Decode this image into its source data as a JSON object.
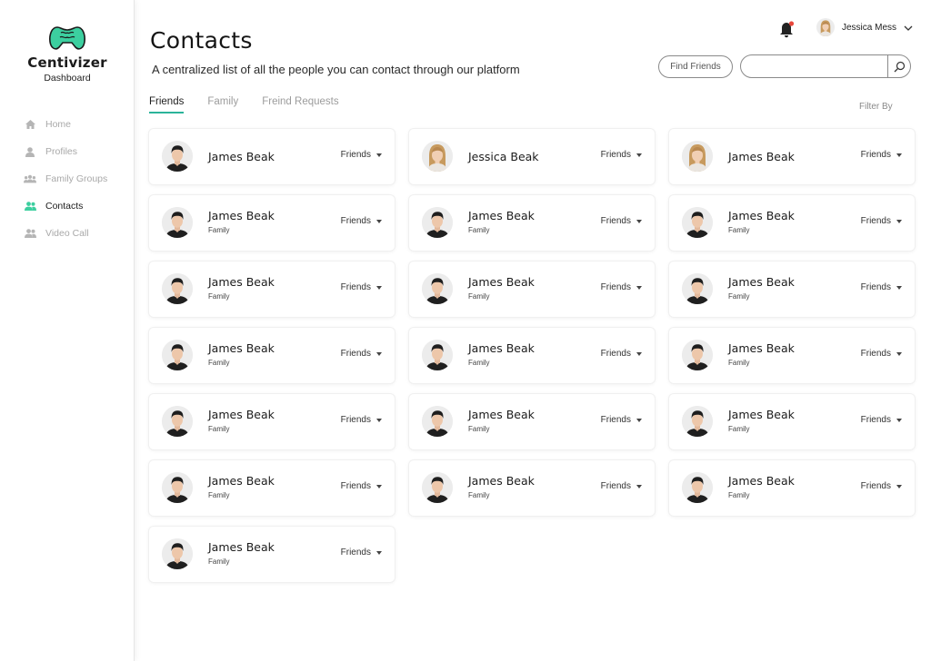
{
  "sidebar": {
    "brand": "Centivizer",
    "brand_sub": "Dashboard",
    "logo_icon": "gamepad-brain-logo",
    "items": [
      {
        "label": "Home",
        "icon": "home-icon",
        "active": false
      },
      {
        "label": "Profiles",
        "icon": "person-icon",
        "active": false
      },
      {
        "label": "Family Groups",
        "icon": "group-icon",
        "active": false
      },
      {
        "label": "Contacts",
        "icon": "contacts-icon",
        "active": true
      },
      {
        "label": "Video Call",
        "icon": "video-call-icon",
        "active": false
      }
    ]
  },
  "header": {
    "title": "Contacts",
    "subtitle": "A centralized list of all the people you can contact through our platform",
    "user_name": "Jessica Mess",
    "find_friends_label": "Find Friends",
    "search_placeholder": ""
  },
  "tabs": [
    {
      "label": "Friends",
      "active": true
    },
    {
      "label": "Family",
      "active": false
    },
    {
      "label": "Freind Requests",
      "active": false
    }
  ],
  "filter_label": "Filter By",
  "contacts": [
    {
      "name": "James Beak",
      "sub": "",
      "status": "Friends",
      "avatar": "male"
    },
    {
      "name": "Jessica Beak",
      "sub": "",
      "status": "Friends",
      "avatar": "female"
    },
    {
      "name": "James Beak",
      "sub": "",
      "status": "Friends",
      "avatar": "female"
    },
    {
      "name": "James Beak",
      "sub": "Family",
      "status": "Friends",
      "avatar": "male"
    },
    {
      "name": "James Beak",
      "sub": "Family",
      "status": "Friends",
      "avatar": "male"
    },
    {
      "name": "James Beak",
      "sub": "Family",
      "status": "Friends",
      "avatar": "male"
    },
    {
      "name": "James Beak",
      "sub": "Family",
      "status": "Friends",
      "avatar": "male"
    },
    {
      "name": "James Beak",
      "sub": "Family",
      "status": "Friends",
      "avatar": "male"
    },
    {
      "name": "James Beak",
      "sub": "Family",
      "status": "Friends",
      "avatar": "male"
    },
    {
      "name": "James Beak",
      "sub": "Family",
      "status": "Friends",
      "avatar": "male"
    },
    {
      "name": "James Beak",
      "sub": "Family",
      "status": "Friends",
      "avatar": "male"
    },
    {
      "name": "James Beak",
      "sub": "Family",
      "status": "Friends",
      "avatar": "male"
    },
    {
      "name": "James Beak",
      "sub": "Family",
      "status": "Friends",
      "avatar": "male"
    },
    {
      "name": "James Beak",
      "sub": "Family",
      "status": "Friends",
      "avatar": "male"
    },
    {
      "name": "James Beak",
      "sub": "Family",
      "status": "Friends",
      "avatar": "male"
    },
    {
      "name": "James Beak",
      "sub": "Family",
      "status": "Friends",
      "avatar": "male"
    },
    {
      "name": "James Beak",
      "sub": "Family",
      "status": "Friends",
      "avatar": "male"
    },
    {
      "name": "James Beak",
      "sub": "Family",
      "status": "Friends",
      "avatar": "male"
    },
    {
      "name": "James Beak",
      "sub": "Family",
      "status": "Friends",
      "avatar": "male"
    }
  ],
  "colors": {
    "accent": "#2bb49a",
    "logo": "#3ccf9f",
    "notification_dot": "#e8473c"
  }
}
